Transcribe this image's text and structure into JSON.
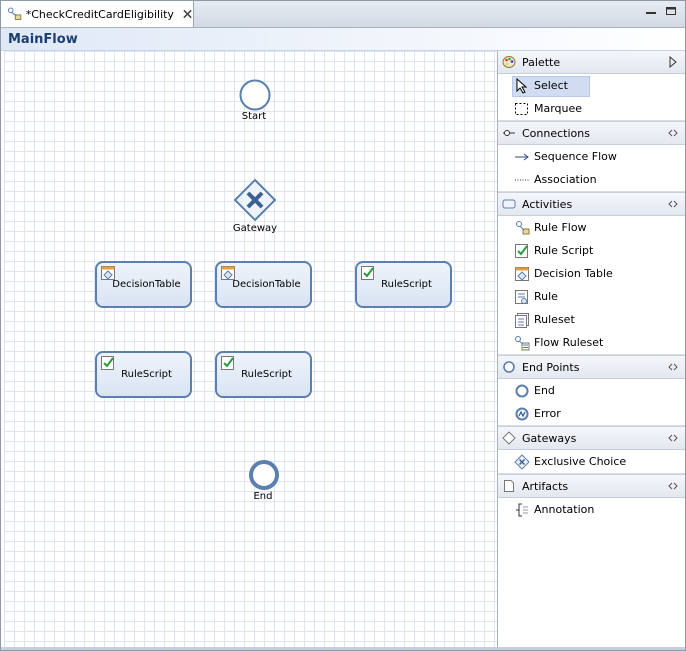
{
  "editor_tab": {
    "title": "*CheckCreditCardEligibility"
  },
  "diagram": {
    "title": "MainFlow",
    "start": {
      "label": "Start"
    },
    "gateway": {
      "label": "Gateway"
    },
    "activities": [
      {
        "label": "DecisionTable",
        "kind": "decision-table"
      },
      {
        "label": "DecisionTable",
        "kind": "decision-table"
      },
      {
        "label": "RuleScript",
        "kind": "rule-script"
      },
      {
        "label": "RuleScript",
        "kind": "rule-script"
      },
      {
        "label": "RuleScript",
        "kind": "rule-script"
      }
    ],
    "end": {
      "label": "End"
    }
  },
  "palette": {
    "title": "Palette",
    "tools": [
      {
        "label": "Select",
        "selected": true
      },
      {
        "label": "Marquee"
      }
    ],
    "groups": [
      {
        "label": "Connections",
        "items": [
          "Sequence Flow",
          "Association"
        ]
      },
      {
        "label": "Activities",
        "items": [
          "Rule Flow",
          "Rule Script",
          "Decision Table",
          "Rule",
          "Ruleset",
          "Flow Ruleset"
        ]
      },
      {
        "label": "End Points",
        "items": [
          "End",
          "Error"
        ]
      },
      {
        "label": "Gateways",
        "items": [
          "Exclusive Choice"
        ]
      },
      {
        "label": "Artifacts",
        "items": [
          "Annotation"
        ]
      }
    ]
  },
  "colors": {
    "accent": "#5b7fae",
    "title": "#1c3f73",
    "grid": "#dfe6ef"
  }
}
